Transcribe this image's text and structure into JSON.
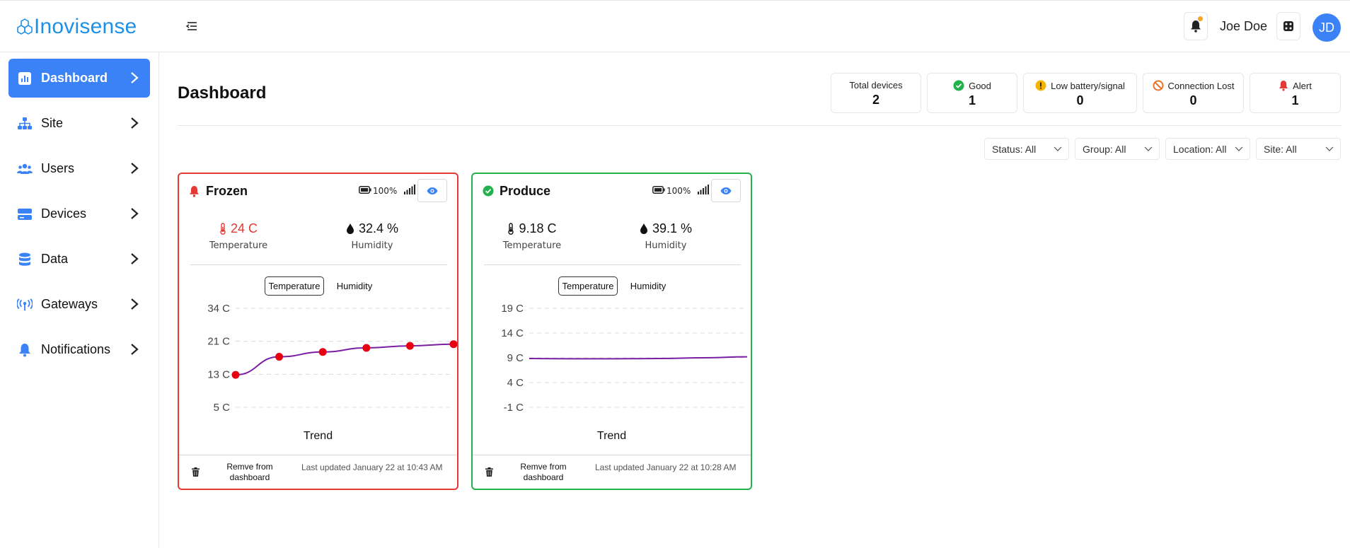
{
  "app": {
    "logo_text": "Inovisense"
  },
  "header": {
    "user_name": "Joe Doe",
    "avatar_initials": "JD"
  },
  "sidebar": {
    "items": [
      {
        "label": "Dashboard",
        "icon": "chart-bar-icon",
        "active": true
      },
      {
        "label": "Site",
        "icon": "sitemap-icon"
      },
      {
        "label": "Users",
        "icon": "users-icon"
      },
      {
        "label": "Devices",
        "icon": "devices-icon"
      },
      {
        "label": "Data",
        "icon": "database-icon"
      },
      {
        "label": "Gateways",
        "icon": "antenna-icon"
      },
      {
        "label": "Notifications",
        "icon": "bell-icon"
      }
    ]
  },
  "main": {
    "title": "Dashboard",
    "stats": [
      {
        "label": "Total devices",
        "value": "2"
      },
      {
        "label": "Good",
        "value": "1",
        "icon": "check-circle-icon"
      },
      {
        "label": "Low battery/signal",
        "value": "0",
        "icon": "warning-circle-icon"
      },
      {
        "label": "Connection Lost",
        "value": "0",
        "icon": "ban-icon"
      },
      {
        "label": "Alert",
        "value": "1",
        "icon": "bell-icon"
      }
    ],
    "filters": [
      {
        "label": "Status: All"
      },
      {
        "label": "Group: All"
      },
      {
        "label": "Location: All"
      },
      {
        "label": "Site: All"
      }
    ]
  },
  "cards": [
    {
      "name": "Frozen",
      "status": "alert",
      "battery": "100%",
      "temperature": "24 C",
      "temperature_label": "Temperature",
      "humidity": "32.4 %",
      "humidity_label": "Humidity",
      "tabs": [
        "Temperature",
        "Humidity"
      ],
      "trend_label": "Trend",
      "remove_label": "Remve from dashboard",
      "updated": "Last updated January 22 at 10:43 AM",
      "chart_data": {
        "type": "line",
        "title": "",
        "xlabel": "Trend",
        "ylabel": "",
        "y_ticks": [
          "34 C",
          "21 C",
          "13 C",
          "5 C"
        ],
        "ylim": [
          5,
          34
        ],
        "series": [
          {
            "values": [
              14.5,
              19.8,
              21.2,
              22.4,
              23.0,
              23.5
            ]
          }
        ],
        "markers": true,
        "line_color": "#7b1fa2",
        "marker_color": "#e60012"
      }
    },
    {
      "name": "Produce",
      "status": "good",
      "battery": "100%",
      "temperature": "9.18 C",
      "temperature_label": "Temperature",
      "humidity": "39.1 %",
      "humidity_label": "Humidity",
      "tabs": [
        "Temperature",
        "Humidity"
      ],
      "trend_label": "Trend",
      "remove_label": "Remve from dashboard",
      "updated": "Last updated January 22 at 10:28 AM",
      "chart_data": {
        "type": "line",
        "title": "",
        "xlabel": "Trend",
        "ylabel": "",
        "y_ticks": [
          "19 C",
          "14 C",
          "9 C",
          "4 C",
          "-1 C"
        ],
        "ylim": [
          -1,
          19
        ],
        "series": [
          {
            "values": [
              8.85,
              8.8,
              8.8,
              8.85,
              9.0,
              9.2
            ]
          }
        ],
        "markers": false,
        "line_color": "#7b1fa2"
      }
    }
  ],
  "colors": {
    "accent": "#3b82f6",
    "logo": "#1e90e6",
    "alert": "#e53935",
    "good": "#22b14c",
    "warning": "#f5b301",
    "ban": "#e8742a"
  }
}
